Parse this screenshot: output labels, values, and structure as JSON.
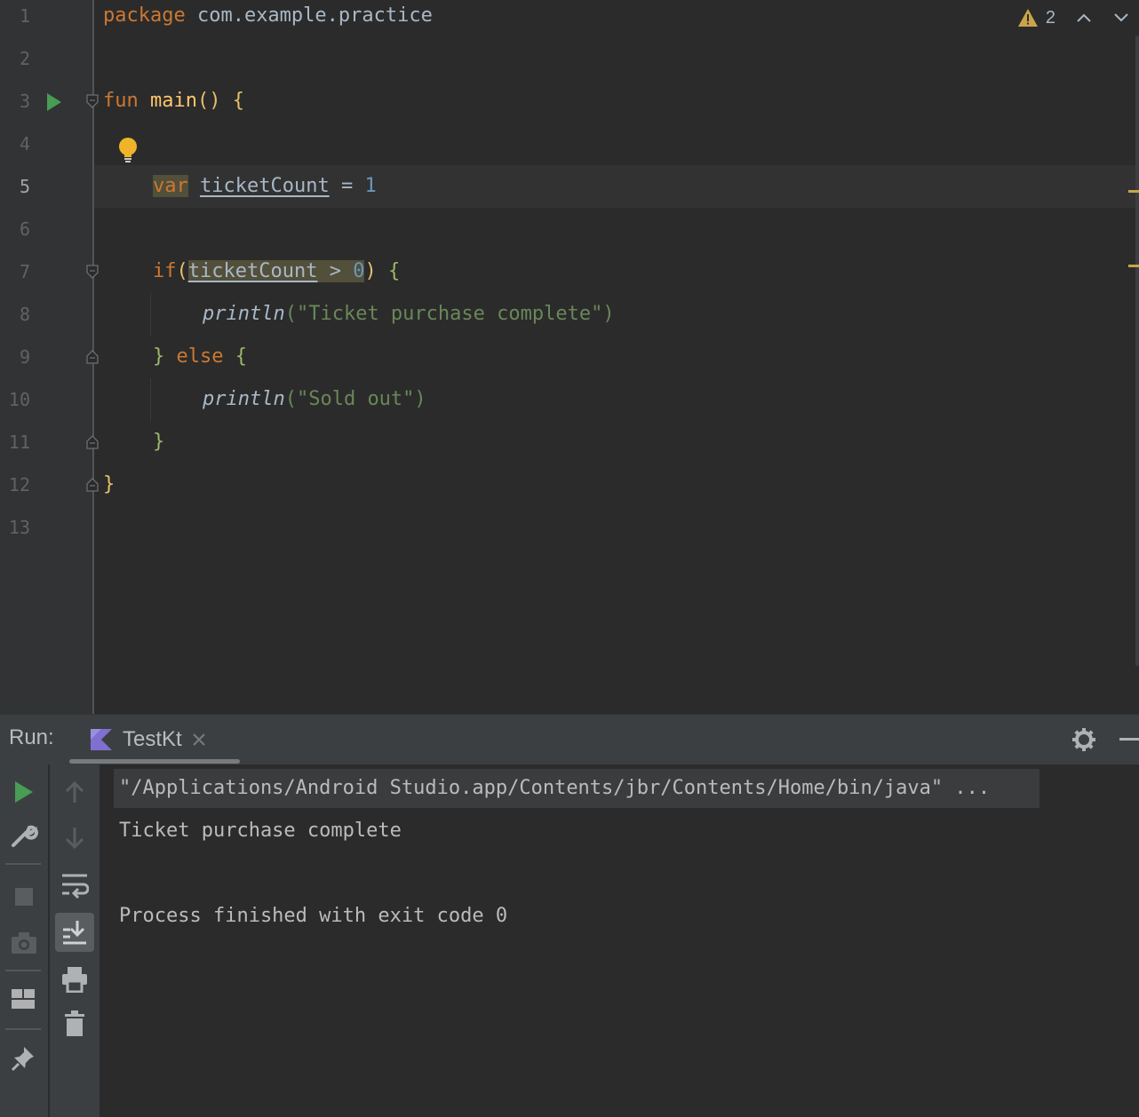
{
  "editor": {
    "line_numbers": [
      "1",
      "2",
      "3",
      "4",
      "5",
      "6",
      "7",
      "8",
      "9",
      "10",
      "11",
      "12",
      "13"
    ],
    "active_line": "5",
    "code": {
      "l1_kw": "package",
      "l1_pkg": " com.example.practice",
      "l3_kw": "fun",
      "l3_name": " main",
      "l3_parens": "()",
      "l3_brace": " {",
      "l5_kw": "var",
      "l5_var": "ticketCount",
      "l5_eq": " = ",
      "l5_num": "1",
      "l7_if": "if",
      "l7_open": "(",
      "l7_var": "ticketCount",
      "l7_gt": " > ",
      "l7_num": "0",
      "l7_close": ")",
      "l7_brace": " {",
      "l8_fn": "println",
      "l8_open": "(",
      "l8_str": "\"Ticket purchase complete\"",
      "l8_close": ")",
      "l9_close": "}",
      "l9_else": " else ",
      "l9_brace": "{",
      "l10_fn": "println",
      "l10_open": "(",
      "l10_str": "\"Sold out\"",
      "l10_close": ")",
      "l11_brace": "}",
      "l12_brace": "}"
    },
    "warnings_count": "2",
    "icons": [
      "run-gutter-icon",
      "intention-bulb-icon",
      "warning-icon",
      "chevron-up-icon",
      "chevron-down-icon",
      "fold-icon"
    ]
  },
  "run_window": {
    "title": "Run:",
    "tab_label": "TestKt",
    "console": {
      "command": "\"/Applications/Android Studio.app/Contents/jbr/Contents/Home/bin/java\" ...",
      "output": "Ticket purchase complete",
      "exit": "Process finished with exit code 0"
    },
    "icons": [
      "kotlin-icon",
      "close-icon",
      "gear-icon",
      "minimize-icon",
      "rerun-icon",
      "wrench-icon",
      "stop-icon",
      "camera-icon",
      "layout-icon",
      "pin-icon",
      "up-arrow-icon",
      "down-arrow-icon",
      "soft-wrap-icon",
      "scroll-to-end-icon",
      "print-icon",
      "trash-icon"
    ]
  },
  "colors": {
    "background": "#2b2b2b",
    "gutter": "#313335",
    "keyword": "#cc7832",
    "function": "#ffc66d",
    "string": "#6a8759",
    "number": "#6897bb",
    "run_green": "#499c54",
    "warning": "#c9a44a"
  }
}
